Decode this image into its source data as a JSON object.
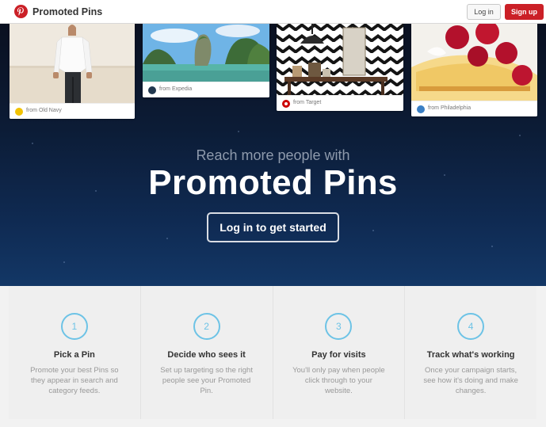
{
  "header": {
    "brand": "Promoted Pins",
    "login_label": "Log in",
    "signup_label": "Sign up",
    "accent_color": "#cb2027"
  },
  "pins": [
    {
      "source": "from Old Navy",
      "image": "man in white shirt on beach",
      "icon": "old-navy-icon"
    },
    {
      "source": "from Expedia",
      "image": "rock islands in turquoise sea",
      "icon": "expedia-icon"
    },
    {
      "source": "from Target",
      "image": "chevron wallpaper with pendant lamp",
      "icon": "target-icon"
    },
    {
      "source": "from Philadelphia",
      "image": "cheesecake with raspberries",
      "icon": "philadelphia-icon"
    }
  ],
  "hero": {
    "subtitle": "Reach more people with",
    "title": "Promoted Pins",
    "cta_label": "Log in to get started"
  },
  "steps": [
    {
      "number": "1",
      "title": "Pick a Pin",
      "description": "Promote your best Pins so they appear in search and category feeds."
    },
    {
      "number": "2",
      "title": "Decide who sees it",
      "description": "Set up targeting so the right people see your Promoted Pin."
    },
    {
      "number": "3",
      "title": "Pay for visits",
      "description": "You'll only pay when people click through to your website."
    },
    {
      "number": "4",
      "title": "Track what's working",
      "description": "Once your campaign starts, see how it's doing and make changes."
    }
  ],
  "colors": {
    "step_accent": "#6dc3e6",
    "hero_bg": "#0f2a52"
  }
}
